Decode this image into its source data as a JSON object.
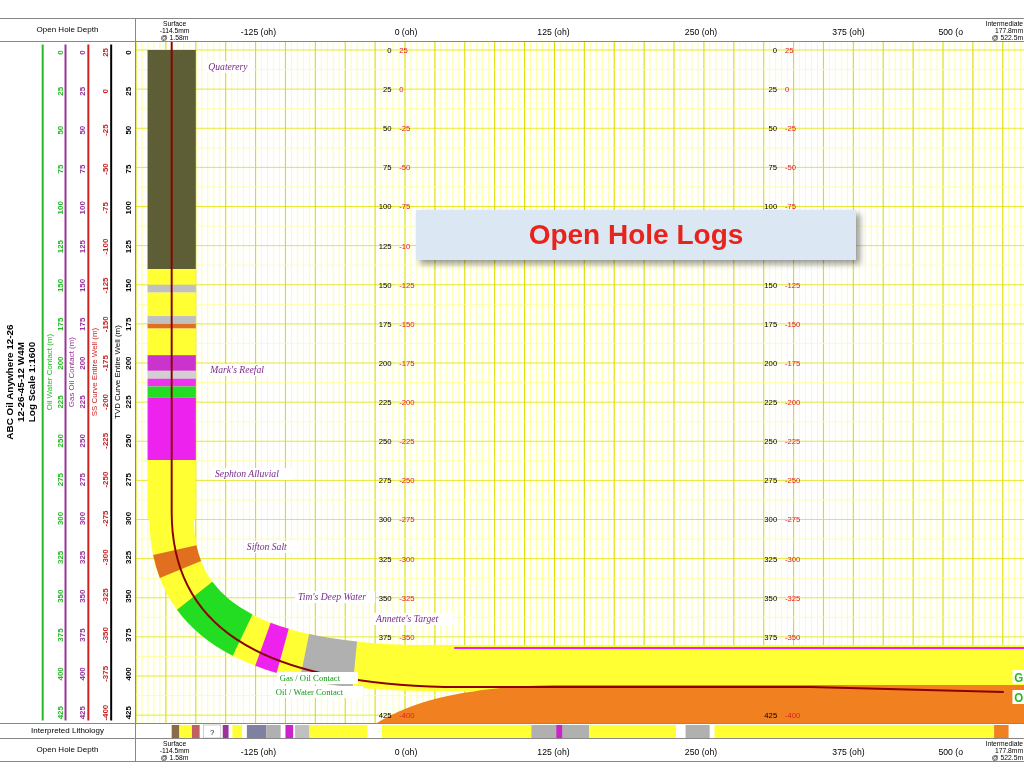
{
  "header": {
    "label": "Open Hole Depth",
    "surface_marker": [
      "Surface",
      "-114.5mm",
      "@ 1.58m"
    ],
    "axis_labels": [
      "-125 (oh)",
      "0 (oh)",
      "125 (oh)",
      "250 (oh)",
      "375 (oh)",
      "500 (o"
    ],
    "end_marker": [
      "Intermediate",
      "177.8mm",
      "@ 522.5m"
    ]
  },
  "well_title": [
    "ABC Oil Anywhere 12-26",
    "12-26-45-12 W4M",
    "Log Scale 1:1600"
  ],
  "depth_tracks": [
    {
      "name": "Oil Water Contact (m)",
      "color": "#22bb22",
      "values": [
        "0",
        "25",
        "50",
        "75",
        "100",
        "125",
        "150",
        "175",
        "200",
        "225",
        "250",
        "275",
        "300",
        "325",
        "350",
        "375",
        "400",
        "425"
      ]
    },
    {
      "name": "Gas Oil Contact (m)",
      "color": "#993399",
      "values": [
        "0",
        "25",
        "50",
        "75",
        "100",
        "125",
        "150",
        "175",
        "200",
        "225",
        "250",
        "275",
        "300",
        "325",
        "350",
        "375",
        "400",
        "425"
      ]
    },
    {
      "name": "SS Curve Entire Well (m)",
      "color": "#cc2222",
      "values": [
        "25",
        "0",
        "-25",
        "-50",
        "-75",
        "-100",
        "-125",
        "-150",
        "-175",
        "-200",
        "-225",
        "-250",
        "-275",
        "-300",
        "-325",
        "-350",
        "-375",
        "-400"
      ]
    },
    {
      "name": "TVD Curve Entire Well (m)",
      "color": "#000000",
      "values": [
        "0",
        "25",
        "50",
        "75",
        "100",
        "125",
        "150",
        "175",
        "200",
        "225",
        "250",
        "275",
        "300",
        "325",
        "350",
        "375",
        "400",
        "425"
      ]
    }
  ],
  "canvas_scales": [
    {
      "rows": [
        {
          "depth": "0",
          "subsea": "25"
        },
        {
          "depth": "25",
          "subsea": "0"
        },
        {
          "depth": "50",
          "subsea": "-25"
        },
        {
          "depth": "75",
          "subsea": "-50"
        },
        {
          "depth": "100",
          "subsea": "-75"
        },
        {
          "depth": "125",
          "subsea": "-10"
        },
        {
          "depth": "150",
          "subsea": "-125"
        },
        {
          "depth": "175",
          "subsea": "-150"
        },
        {
          "depth": "200",
          "subsea": "-175"
        },
        {
          "depth": "225",
          "subsea": "-200"
        },
        {
          "depth": "250",
          "subsea": "-225"
        },
        {
          "depth": "275",
          "subsea": "-250"
        },
        {
          "depth": "300",
          "subsea": "-275"
        },
        {
          "depth": "325",
          "subsea": "-300"
        },
        {
          "depth": "350",
          "subsea": "-325"
        },
        {
          "depth": "375",
          "subsea": "-350"
        },
        {
          "depth": "425",
          "subsea": "-400"
        }
      ]
    },
    {
      "rows": [
        {
          "depth": "0",
          "subsea": "25"
        },
        {
          "depth": "25",
          "subsea": "0"
        },
        {
          "depth": "50",
          "subsea": "-25"
        },
        {
          "depth": "75",
          "subsea": "-50"
        },
        {
          "depth": "100",
          "subsea": "-75"
        },
        {
          "depth": "150",
          "subsea": "-125"
        },
        {
          "depth": "175",
          "subsea": "-150"
        },
        {
          "depth": "200",
          "subsea": "-175"
        },
        {
          "depth": "225",
          "subsea": "-200"
        },
        {
          "depth": "250",
          "subsea": "-225"
        },
        {
          "depth": "275",
          "subsea": "-250"
        },
        {
          "depth": "300",
          "subsea": "-275"
        },
        {
          "depth": "325",
          "subsea": "-300"
        },
        {
          "depth": "350",
          "subsea": "-325"
        },
        {
          "depth": "375",
          "subsea": "-350"
        },
        {
          "depth": "425",
          "subsea": "-400"
        }
      ]
    }
  ],
  "formations": [
    {
      "name": "Quaterery",
      "kind": "formation"
    },
    {
      "name": "Mark's Reefal",
      "kind": "formation"
    },
    {
      "name": "Sephton Alluvial",
      "kind": "formation"
    },
    {
      "name": "Sifton Salt",
      "kind": "formation"
    },
    {
      "name": "Tim's Deep Water",
      "kind": "formation"
    },
    {
      "name": "Annette's Target",
      "kind": "formation"
    },
    {
      "name": "Gas / Oil Contact",
      "kind": "contact"
    },
    {
      "name": "Oil / Water Contact",
      "kind": "contact"
    }
  ],
  "edge_labels": [
    {
      "text": "G",
      "color": "#22bb22"
    },
    {
      "text": "O",
      "color": "#22bb22"
    }
  ],
  "banner": {
    "title": "Open Hole Logs"
  },
  "lithology_row": {
    "label": "Interpreted Lithology",
    "unknown_marks": [
      "?"
    ]
  },
  "footer": {
    "label": "Open Hole Depth",
    "surface_marker": [
      "Surface",
      "-114.5mm",
      "@ 1.58m"
    ],
    "axis_labels": [
      "-125 (oh)",
      "0 (oh)",
      "125 (oh)",
      "250 (oh)",
      "375 (oh)",
      "500 (o"
    ],
    "end_marker": [
      "Intermediate",
      "177.8mm",
      "@ 522.5m"
    ]
  }
}
